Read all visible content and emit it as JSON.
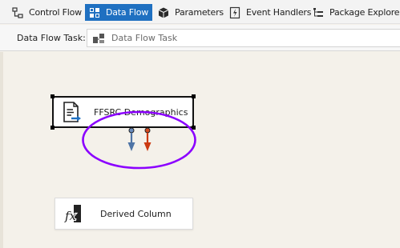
{
  "tabs": [
    {
      "label": "Control Flow",
      "icon": "control-flow-icon",
      "active": false
    },
    {
      "label": "Data Flow",
      "icon": "data-flow-icon",
      "active": true
    },
    {
      "label": "Parameters",
      "icon": "parameters-icon",
      "active": false
    },
    {
      "label": "Event Handlers",
      "icon": "event-handlers-icon",
      "active": false
    },
    {
      "label": "Package Explorer",
      "icon": "package-explorer-icon",
      "active": false
    }
  ],
  "task_bar": {
    "label": "Data Flow Task:",
    "selected": "Data Flow Task",
    "icon": "data-flow-task-icon"
  },
  "components": {
    "source": {
      "label": "FFSRC Demographics",
      "icon": "flat-file-source-icon"
    },
    "derived": {
      "label": "Derived Column",
      "icon": "derived-column-fx-icon"
    }
  },
  "paths": {
    "success": {
      "color": "#4e74a6",
      "icon": "blue-path-arrow-icon"
    },
    "error": {
      "color": "#cc3a12",
      "icon": "red-path-arrow-icon"
    }
  },
  "highlight": {
    "color": "#8b00ff",
    "icon": "purple-highlight-ellipse"
  },
  "colors": {
    "active_tab": "#1f70c1",
    "canvas": "#f4f1ea",
    "toolbar": "#f3f3f3"
  }
}
